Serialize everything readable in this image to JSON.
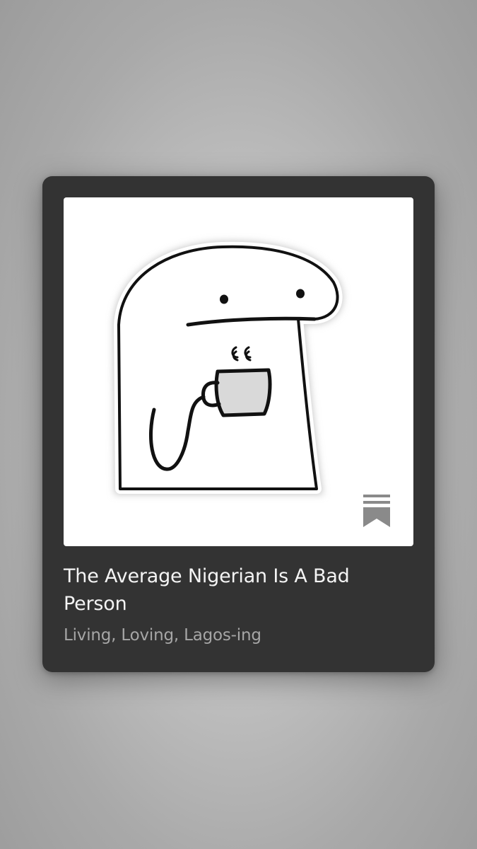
{
  "card": {
    "title": "The Average Nigerian Is A Bad Person",
    "subtitle": "Living, Loving, Lagos-ing",
    "cover_icon": "sleepy-blob-holding-coffee-cup",
    "bookmark_icon": "bookmark-icon"
  },
  "colors": {
    "page_background": "#b3b3b3",
    "card_background": "#333333",
    "title_text": "#f4f4f4",
    "subtitle_text": "#a6a6a6",
    "bookmark": "#8a8a8a"
  }
}
